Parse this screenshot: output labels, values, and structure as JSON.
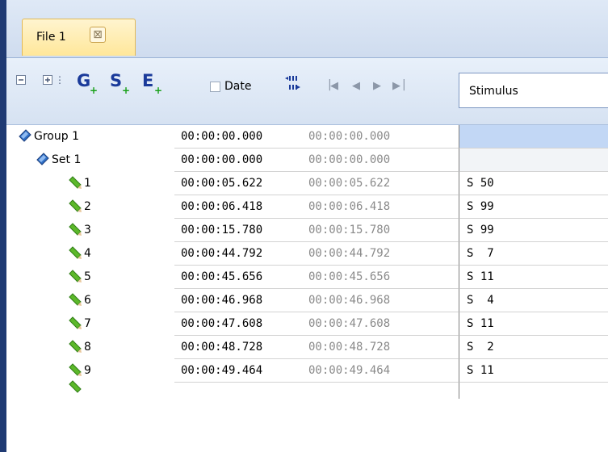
{
  "tab": {
    "label": "File 1",
    "close_glyph": "⊠"
  },
  "toolbar": {
    "collapse_icon": "collapse-all-icon",
    "expand_icon": "expand-all-icon",
    "group_label": "G",
    "set_label": "S",
    "event_label": "E",
    "plus": "+",
    "date_label": "Date",
    "date_checked": false,
    "stimulus_value": "Stimulus"
  },
  "tree": [
    {
      "label": "Group 1",
      "kind": "group",
      "t1": "00:00:00.000",
      "t2": "00:00:00.000",
      "stim": "",
      "state": "selected"
    },
    {
      "label": "Set 1",
      "kind": "set",
      "t1": "00:00:00.000",
      "t2": "00:00:00.000",
      "stim": "",
      "state": "grey"
    },
    {
      "label": "1",
      "kind": "event",
      "t1": "00:00:05.622",
      "t2": "00:00:05.622",
      "stim": "S 50"
    },
    {
      "label": "2",
      "kind": "event",
      "t1": "00:00:06.418",
      "t2": "00:00:06.418",
      "stim": "S 99"
    },
    {
      "label": "3",
      "kind": "event",
      "t1": "00:00:15.780",
      "t2": "00:00:15.780",
      "stim": "S 99"
    },
    {
      "label": "4",
      "kind": "event",
      "t1": "00:00:44.792",
      "t2": "00:00:44.792",
      "stim": "S  7"
    },
    {
      "label": "5",
      "kind": "event",
      "t1": "00:00:45.656",
      "t2": "00:00:45.656",
      "stim": "S 11"
    },
    {
      "label": "6",
      "kind": "event",
      "t1": "00:00:46.968",
      "t2": "00:00:46.968",
      "stim": "S  4"
    },
    {
      "label": "7",
      "kind": "event",
      "t1": "00:00:47.608",
      "t2": "00:00:47.608",
      "stim": "S 11"
    },
    {
      "label": "8",
      "kind": "event",
      "t1": "00:00:48.728",
      "t2": "00:00:48.728",
      "stim": "S  2"
    },
    {
      "label": "9",
      "kind": "event",
      "t1": "00:00:49.464",
      "t2": "00:00:49.464",
      "stim": "S 11"
    }
  ],
  "colors": {
    "accent": "#1a3a9a",
    "plus_green": "#18a018",
    "selection": "#c2d7f5"
  }
}
